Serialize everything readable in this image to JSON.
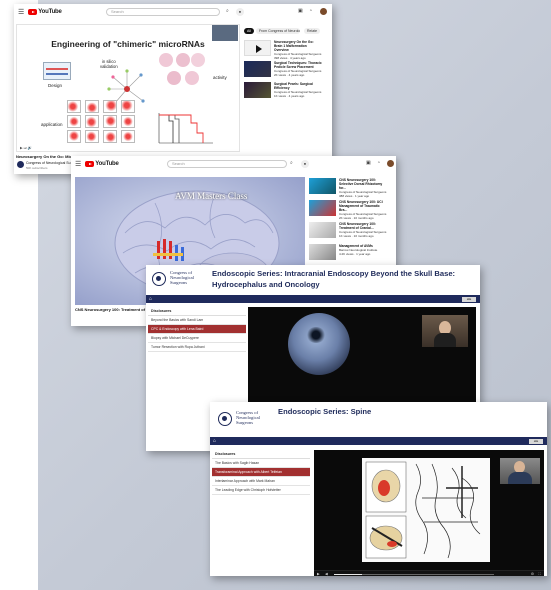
{
  "youtube_search_placeholder": "Search",
  "youtube_brand": "YouTube",
  "window1": {
    "slide_title": "Engineering of \"chimeric\" microRNAs",
    "labels": {
      "design": "Design",
      "in_silico": "in silico\nvalidation",
      "activity": "activity",
      "application": "application"
    },
    "video_title": "Neurosurgery On the Go: Micr",
    "channel": "Congress of Neurological Su",
    "channel_subs": "50K subscribers",
    "chips": [
      "All",
      "From Congress of Neurologi...",
      "Relate"
    ],
    "related": [
      {
        "title": "Neurosurgery On the Go: Brain 1 Malformation Overview",
        "channel": "Congress of Neurological Surgeons",
        "meta": "398 views · 4 years ago"
      },
      {
        "title": "Surgical Techniques: Thoracic Pedicle Screw Placement",
        "channel": "Congress of Neurological Surgeons",
        "meta": "2K views · 4 years ago"
      },
      {
        "title": "Surgical Pearls: Surgical Efficiency",
        "channel": "Congress of Neurological Surgeons",
        "meta": "1K views · 4 years ago"
      }
    ]
  },
  "window2": {
    "overlay_text": "AVM Masters Class",
    "video_title": "CNS Neurosurgery 100: Treatment of A",
    "related": [
      {
        "title": "CNS Neurosurgery 100: Selective Dorsal Rhizotomy for...",
        "channel": "Congress of Neurological Surgeons",
        "meta": "388 views · 1 year ago"
      },
      {
        "title": "CNS Neurosurgery 100: UCI Management of Traumatic Bra...",
        "channel": "Congress of Neurological Surgeons",
        "meta": "2K views · 10 months ago"
      },
      {
        "title": "CNS Neurosurgery 100: Treatment of Cranial...",
        "channel": "Congress of Neurological Surgeons",
        "meta": "1K views · 10 months ago"
      },
      {
        "title": "Management of AVMs",
        "channel": "Barrow Neurological Institute",
        "meta": "4.2K views · 1 year ago"
      }
    ]
  },
  "window3": {
    "org_name": "Congress of\nNeurological\nSurgeons",
    "title": "Endoscopic Series: Intracranial Endoscopy Beyond the Skull Base: Hydrocephalus and Oncology",
    "chapters_head": "Disclosures",
    "chapters": [
      {
        "label": "Beyond the Basics with Sandi Lam",
        "active": false
      },
      {
        "label": "CPC & Endoscopy with Lena Baird",
        "active": true
      },
      {
        "label": "Biopsy with Michael DeCuypere",
        "active": false
      },
      {
        "label": "Tumor Resection with Rupa Juthani",
        "active": false
      }
    ]
  },
  "window4": {
    "org_name": "Congress of\nNeurological\nSurgeons",
    "title": "Endoscopic Series: Spine",
    "chapters_head": "Disclosures",
    "chapters": [
      {
        "label": "The Basics with Sagib Hasan",
        "active": false
      },
      {
        "label": "Transforaminal Approach with Albert Telfeian",
        "active": true
      },
      {
        "label": "Interlaminar Approach with Mark Mahan",
        "active": false
      },
      {
        "label": "The Leading Edge with Christoph Hofstetter",
        "active": false
      }
    ]
  },
  "colors": {
    "youtube_red": "#ee0000",
    "cns_navy": "#1f2a5c",
    "active_chapter": "#a23030"
  }
}
